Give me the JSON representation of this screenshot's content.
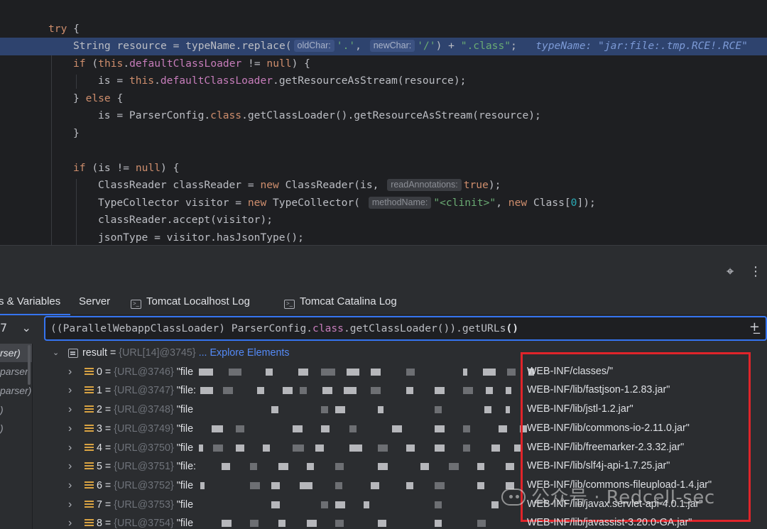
{
  "editor": {
    "lines": [
      {
        "text": "try {"
      },
      {
        "text": "String resource = typeName.replace(oldChar: '.', newChar: '/') + \".class\";  typeName: \"jar:file:.tmp.RCE!.RCE\""
      },
      {
        "text": "if (this.defaultClassLoader != null) {"
      },
      {
        "text": "is = this.defaultClassLoader.getResourceAsStream(resource);"
      },
      {
        "text": "} else {"
      },
      {
        "text": "is = ParserConfig.class.getClassLoader().getResourceAsStream(resource);"
      },
      {
        "text": "}"
      },
      {
        "text": ""
      },
      {
        "text": "if (is != null) {"
      },
      {
        "text": "ClassReader classReader = new ClassReader(is, readAnnotations: true);"
      },
      {
        "text": "TypeCollector visitor = new TypeCollector( methodName: \"<clinit>\", new Class[0]);"
      },
      {
        "text": "classReader.accept(visitor);"
      },
      {
        "text": "jsonType = visitor.hasJsonType();"
      }
    ],
    "hints": {
      "old_char": "oldChar:",
      "new_char": "newChar:",
      "read_annotations": "readAnnotations:",
      "method_name": "methodName:"
    },
    "inline_value": "typeName: \"jar:file:.tmp.RCE!.RCE\""
  },
  "debug": {
    "tabs": [
      {
        "label": "s & Variables",
        "active": true
      },
      {
        "label": "Server",
        "active": false
      },
      {
        "label": "Tomcat Localhost Log",
        "active": false,
        "icon": "console-icon"
      },
      {
        "label": "Tomcat Catalina Log",
        "active": false,
        "icon": "console-icon"
      }
    ],
    "expression": {
      "prefix": "((ParallelWebappClassLoader) ParserConfig.",
      "keyword": "class",
      "suffix": ".getClassLoader()).getURLs",
      "parens": "()"
    },
    "frames": [
      {
        "label": "rser)",
        "selected": true
      },
      {
        "label": "parser,",
        "selected": false
      },
      {
        "label": "parser)",
        "selected": false
      },
      {
        "label": ")",
        "selected": false
      },
      {
        "label": ")",
        "selected": false
      }
    ],
    "result": {
      "name": "result",
      "ref": "{URL[14]@3745}",
      "link": "... Explore Elements"
    },
    "elements": [
      {
        "index": "0",
        "ref": "{URL@3746}",
        "prefix": "\"file",
        "path": "WEB-INF/classes/\""
      },
      {
        "index": "1",
        "ref": "{URL@3747}",
        "prefix": "\"file:",
        "path": "WEB-INF/lib/fastjson-1.2.83.jar\""
      },
      {
        "index": "2",
        "ref": "{URL@3748}",
        "prefix": "\"file",
        "path": "WEB-INF/lib/jstl-1.2.jar\""
      },
      {
        "index": "3",
        "ref": "{URL@3749}",
        "prefix": "\"file",
        "path": "WEB-INF/lib/commons-io-2.11.0.jar\""
      },
      {
        "index": "4",
        "ref": "{URL@3750}",
        "prefix": "\"file",
        "path": "WEB-INF/lib/freemarker-2.3.32.jar\""
      },
      {
        "index": "5",
        "ref": "{URL@3751}",
        "prefix": "\"file:",
        "path": "WEB-INF/lib/slf4j-api-1.7.25.jar\""
      },
      {
        "index": "6",
        "ref": "{URL@3752}",
        "prefix": "\"file",
        "path": "WEB-INF/lib/commons-fileupload-1.4.jar\""
      },
      {
        "index": "7",
        "ref": "{URL@3753}",
        "prefix": "\"file",
        "path": "WEB-INF/lib/javax.servlet-api-4.0.1.jar\""
      },
      {
        "index": "8",
        "ref": "{URL@3754}",
        "prefix": "\"file",
        "path": "WEB-INF/lib/javassist-3.20.0-GA.jar\""
      }
    ]
  },
  "watermark": "公众号 · Redcell-sec",
  "colors": {
    "accent": "#3574f0",
    "annotation": "#e0242a",
    "keyword": "#cf8e6d",
    "field": "#c77dbb",
    "string": "#6aab73"
  }
}
